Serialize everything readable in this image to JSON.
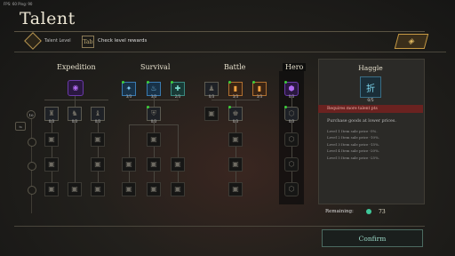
{
  "status": {
    "fps": "FPS: 60  Ping: 90"
  },
  "header": {
    "title": "Talent",
    "level_label": "Talent Level",
    "tab_key": "Tab",
    "tab_hint": "Check level rewards",
    "level_value": "10"
  },
  "categories": [
    "Expedition",
    "Survival",
    "Battle",
    "Hero"
  ],
  "nodes": {
    "exp_top": "",
    "exp1": "0/3",
    "exp2": "0/3",
    "exp3": "0/3",
    "sur1": "3/3",
    "sur2": "3/3",
    "sur3": "2/3",
    "sur_mid": "0/3",
    "bat1": "3/3",
    "bat2": "3/3",
    "bat3": "0/3",
    "bat_mid": "0/3",
    "hero_top": "0/3",
    "hero_mid": "0/3"
  },
  "panel": {
    "title": "Haggle",
    "icon_char": "折",
    "count": "0/5",
    "warning": "Requires more talent pts",
    "description": "Purchase goods at lower prices.",
    "levels": [
      "Level 1   Item sale price -5%.",
      "Level 2   Item sale price -10%.",
      "Level 3   Item sale price -15%.",
      "Level 4   Item sale price -20%.",
      "Level 5   Item sale price -25%."
    ],
    "remaining_label": "Remaining:",
    "remaining_value": "73",
    "confirm": "Confirm"
  },
  "colors": {
    "accent": "#3ccf3a",
    "gold": "#c79a44",
    "confirm": "#9bd9c8"
  }
}
